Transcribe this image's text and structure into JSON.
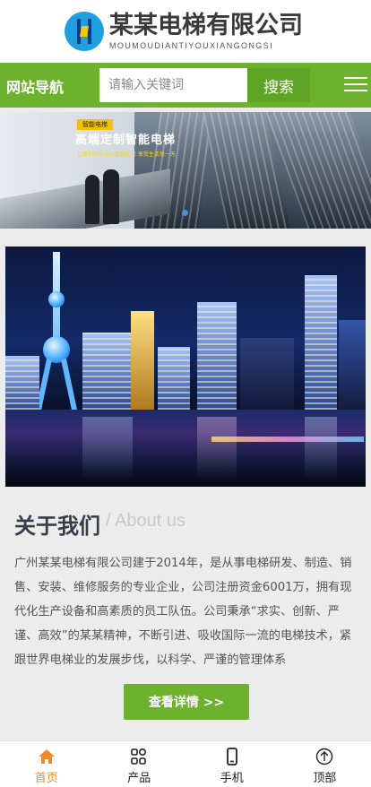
{
  "header": {
    "logo_cn": "某某电梯有限公司",
    "logo_en": "MOUMOUDIANTIYOUXIANGONGSI"
  },
  "navbar": {
    "title": "网站导航",
    "search_placeholder": "请输入关键词",
    "search_button": "搜索"
  },
  "banner": {
    "tag": "智能电梯",
    "title": "高端定制智能电梯",
    "subtitle": "让我们的安全与智慧同行  享受生活每一天"
  },
  "about": {
    "title": "关于我们",
    "title_en": "/ About us",
    "text": "广州某某电梯有限公司建于2014年，是从事电梯研发、制造、销售、安装、维修服务的专业企业，公司注册资金6001万，拥有现代化生产设备和高素质的员工队伍。公司秉承“求实、创新、严谨、高效”的某某精神，不断引进、吸收国际一流的电梯技术，紧跟世界电梯业的发展步伐，以科学、严谨的管理体系",
    "more_button": "查看详情 >>"
  },
  "bottom_nav": {
    "items": [
      {
        "label": "首页",
        "icon": "home-icon",
        "active": true
      },
      {
        "label": "产品",
        "icon": "grid-icon",
        "active": false
      },
      {
        "label": "手机",
        "icon": "phone-icon",
        "active": false
      },
      {
        "label": "顶部",
        "icon": "arrow-up-circle-icon",
        "active": false
      }
    ]
  },
  "colors": {
    "brand_green": "#6cb22d",
    "active_orange": "#f08a24",
    "logo_blue": "#1f9fe0"
  }
}
